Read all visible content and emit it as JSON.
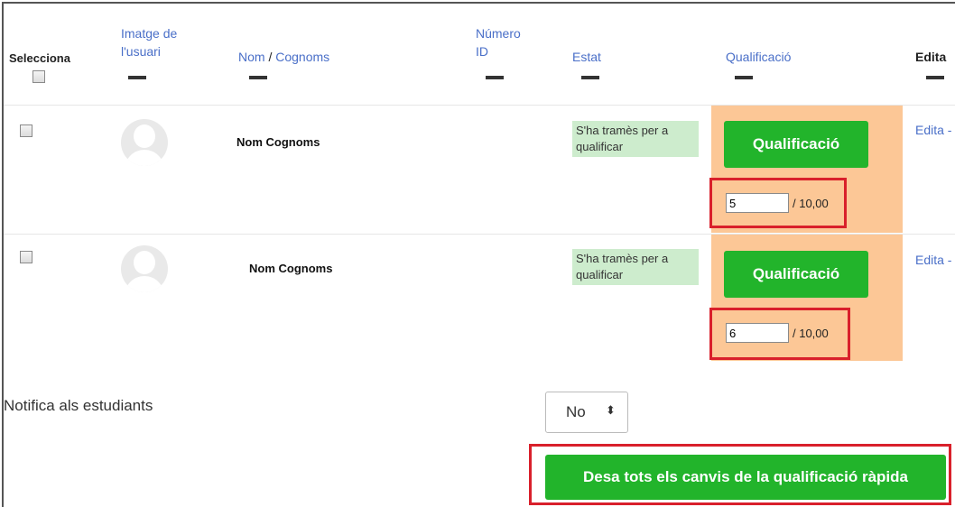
{
  "header": {
    "select": "Selecciona",
    "image_line1": "Imatge de",
    "image_line2": "l'usuari",
    "name": "Nom",
    "slash": " / ",
    "surname": "Cognoms",
    "idnum_line1": "Número",
    "idnum_line2": "ID",
    "status": "Estat",
    "grade": "Qualificació",
    "edit": "Edita"
  },
  "rows": [
    {
      "name": "Nom Cognoms",
      "status_line1": "S'ha tramès per a",
      "status_line2": "qualificar",
      "grade_button": "Qualificació",
      "grade_value": "5",
      "grade_max": "/ 10,00",
      "edit": "Edita -"
    },
    {
      "name": "Nom Cognoms",
      "status_line1": "S'ha tramès per a",
      "status_line2": "qualificar",
      "grade_button": "Qualificació",
      "grade_value": "6",
      "grade_max": "/ 10,00",
      "edit": "Edita -"
    }
  ],
  "notify": {
    "label": "Notifica als estudiants",
    "selected": "No",
    "arrows": "⬍"
  },
  "save_button": "Desa tots els canvis de la qualificació ràpida",
  "colors": {
    "accent_green": "#22b42b",
    "grade_cell_bg": "#fcc796",
    "status_bg": "#cdeccd",
    "highlight_red": "#d9202b",
    "link_blue": "#4a6fc8"
  }
}
